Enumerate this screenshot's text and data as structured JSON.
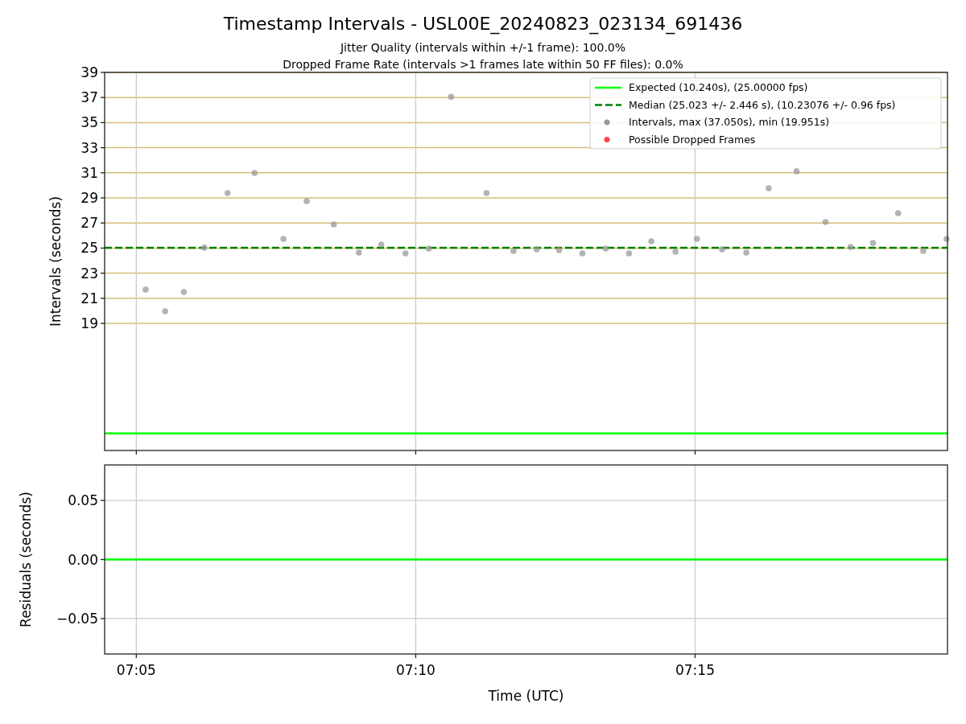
{
  "figure": {
    "title": "Timestamp Intervals - USL00E_20240823_023134_691436",
    "subtitles": [
      "Jitter Quality (intervals within +/-1 frame): 100.0%",
      "Dropped Frame Rate (intervals >1 frames late within 50 FF files): 0.0%"
    ]
  },
  "intervals_plot": {
    "chart_data": {
      "type": "scatter",
      "ylabel": "Intervals (seconds)",
      "grid": true,
      "legend": true,
      "xlim": [
        25466,
        26371
      ],
      "ylim": [
        8.87,
        39
      ],
      "yticks": [
        {
          "value": 19,
          "label": "19"
        },
        {
          "value": 21,
          "label": "21"
        },
        {
          "value": 23,
          "label": "23"
        },
        {
          "value": 25,
          "label": "25"
        },
        {
          "value": 27,
          "label": "27"
        },
        {
          "value": 29,
          "label": "29"
        },
        {
          "value": 31,
          "label": "31"
        },
        {
          "value": 33,
          "label": "33"
        },
        {
          "value": 35,
          "label": "35"
        },
        {
          "value": 37,
          "label": "37"
        },
        {
          "value": 39,
          "label": "39"
        }
      ],
      "x": [
        25510,
        25531,
        25551,
        25573,
        25598,
        25627,
        25658,
        25683,
        25712,
        25739,
        25763,
        25789,
        25814,
        25838,
        25876,
        25905,
        25930,
        25954,
        25979,
        26004,
        26029,
        26053,
        26079,
        26102,
        26129,
        26155,
        26179,
        26209,
        26240,
        26267,
        26291,
        26318,
        26345,
        26370
      ],
      "ref_lines": [
        {
          "axis": "y",
          "value": 10.24,
          "label": "Expected (10.240s), (25.00000 fps)",
          "color": "#00ff00"
        },
        {
          "axis": "y",
          "value": 25.023,
          "label": "Median (25.023 +/- 2.446 s), (10.23076 +/- 0.96 fps)",
          "color": "#008000"
        }
      ],
      "series": [
        {
          "name": "Intervals, max (37.050s), min (19.951s)",
          "color": "#999999",
          "values": [
            21.69,
            19.96,
            21.5,
            25.03,
            29.38,
            30.99,
            25.73,
            28.74,
            26.88,
            24.64,
            25.28,
            24.58,
            24.96,
            37.05,
            29.38,
            24.77,
            24.9,
            24.83,
            24.58,
            24.96,
            24.58,
            25.54,
            24.71,
            25.73,
            24.9,
            24.64,
            29.77,
            31.12,
            27.08,
            25.09,
            25.41,
            27.78,
            24.77,
            25.73
          ]
        },
        {
          "name": "Possible Dropped Frames",
          "color": "#ff4444",
          "values": [
            null,
            null,
            null,
            null,
            null,
            null,
            null,
            null,
            null,
            null,
            null,
            null,
            null,
            null,
            null,
            null,
            null,
            null,
            null,
            null,
            null,
            null,
            null,
            null,
            null,
            null,
            null,
            null,
            null,
            null,
            null,
            null,
            null,
            null
          ]
        }
      ]
    }
  },
  "residuals_plot": {
    "chart_data": {
      "type": "line",
      "xlabel": "Time (UTC)",
      "ylabel": "Residuals (seconds)",
      "grid": true,
      "xlim": [
        25466,
        26371
      ],
      "ylim": [
        -0.08,
        0.08
      ],
      "xticks": [
        {
          "value": 25500,
          "label": "07:05"
        },
        {
          "value": 25800,
          "label": "07:10"
        },
        {
          "value": 26100,
          "label": "07:15"
        }
      ],
      "yticks": [
        {
          "value": 0.05,
          "label": "0.05"
        },
        {
          "value": 0,
          "label": "0.00"
        },
        {
          "value": -0.05,
          "label": "−0.05"
        }
      ],
      "x": [
        25466,
        26371
      ],
      "series": [
        {
          "color": "#00ff00",
          "values": [
            0,
            0
          ]
        }
      ]
    }
  }
}
